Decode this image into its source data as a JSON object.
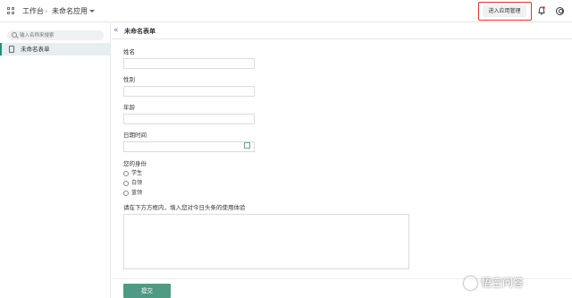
{
  "topbar": {
    "breadcrumb": [
      "工作台",
      "未命名应用"
    ],
    "manage_button": "进入应用管理"
  },
  "sidebar": {
    "search_placeholder": "输入名称来搜索",
    "items": [
      {
        "label": "未命名表单"
      }
    ]
  },
  "form": {
    "title": "未命名表单",
    "fields": {
      "name": {
        "label": "姓名",
        "value": ""
      },
      "gender": {
        "label": "性别",
        "value": ""
      },
      "age": {
        "label": "年龄",
        "value": ""
      },
      "datetime": {
        "label": "日期时间",
        "value": ""
      }
    },
    "identity": {
      "label": "您的身份",
      "options": [
        "学生",
        "白领",
        "蓝领"
      ]
    },
    "feedback": {
      "label": "请在下方方框内，填入您对今日头条的使用体验",
      "value": ""
    },
    "submit_label": "提交"
  },
  "watermark": "悟空问答",
  "colors": {
    "accent": "#4f9a84",
    "highlight_border": "#e0361f",
    "sidebar_active": "#e6eef0"
  }
}
